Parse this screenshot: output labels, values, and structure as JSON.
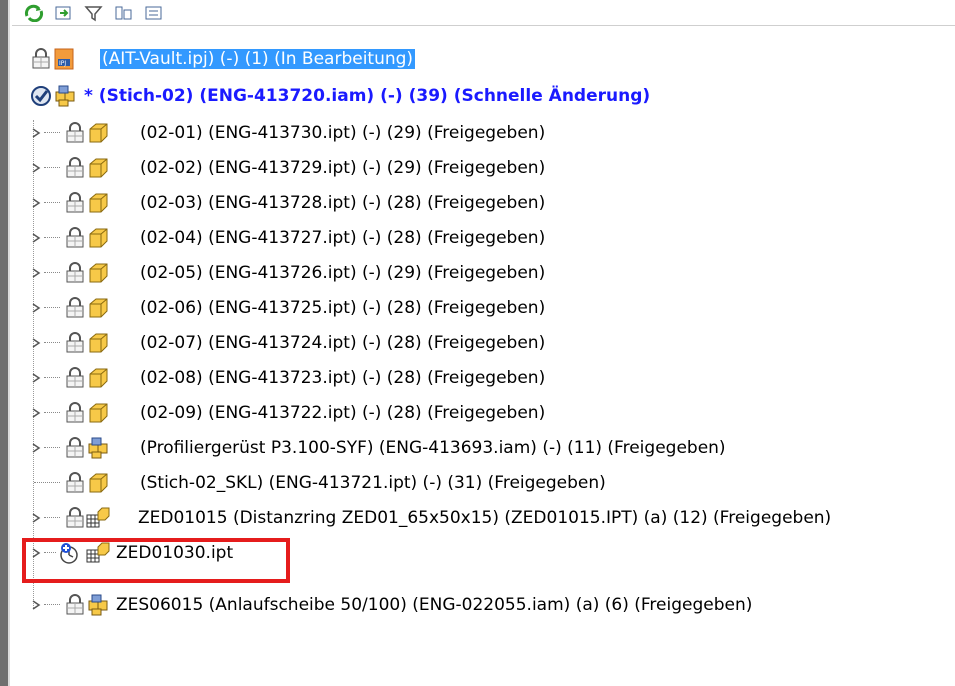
{
  "toolbar": {
    "buttons": [
      {
        "icon": "refresh-icon"
      },
      {
        "icon": "expand-all-icon"
      },
      {
        "icon": "filter-icon"
      },
      {
        "icon": "settings-icon"
      },
      {
        "icon": "list-icon"
      }
    ]
  },
  "tree": {
    "project": {
      "label": "(AIT-Vault.ipj) (-) (1) (In Bearbeitung)"
    },
    "assembly": {
      "label": "* (Stich-02) (ENG-413720.iam) (-) (39) (Schnelle Änderung)"
    },
    "children": [
      {
        "label": "(02-01) (ENG-413730.ipt) (-) (29) (Freigegeben)",
        "type": "part"
      },
      {
        "label": "(02-02) (ENG-413729.ipt) (-) (29) (Freigegeben)",
        "type": "part"
      },
      {
        "label": "(02-03) (ENG-413728.ipt) (-) (28) (Freigegeben)",
        "type": "part"
      },
      {
        "label": "(02-04) (ENG-413727.ipt) (-) (28) (Freigegeben)",
        "type": "part"
      },
      {
        "label": "(02-05) (ENG-413726.ipt) (-) (29) (Freigegeben)",
        "type": "part"
      },
      {
        "label": "(02-06) (ENG-413725.ipt) (-) (28) (Freigegeben)",
        "type": "part"
      },
      {
        "label": "(02-07) (ENG-413724.ipt) (-) (28) (Freigegeben)",
        "type": "part"
      },
      {
        "label": "(02-08) (ENG-413723.ipt) (-) (28) (Freigegeben)",
        "type": "part"
      },
      {
        "label": "(02-09) (ENG-413722.ipt) (-) (28) (Freigegeben)",
        "type": "part"
      },
      {
        "label": "(Profiliergerüst P3.100-SYF) (ENG-413693.iam) (-) (11) (Freigegeben)",
        "type": "assembly"
      },
      {
        "label": "(Stich-02_SKL) (ENG-413721.ipt) (-) (31) (Freigegeben)",
        "type": "part"
      },
      {
        "label": "ZED01015 (Distanzring ZED01_65x50x15) (ZED01015.IPT) (a) (12) (Freigegeben)",
        "type": "library-part"
      },
      {
        "label": "ZED01030.ipt",
        "type": "library-part-new"
      },
      {
        "label": "ZES06015 (Anlaufscheibe 50/100) (ENG-022055.iam) (a) (6) (Freigegeben)",
        "type": "assembly"
      }
    ]
  },
  "colors": {
    "selection": "#3399ff",
    "assembly_text": "#1a1aff",
    "highlight": "#e51c1c",
    "part_fill": "#f7c948"
  }
}
